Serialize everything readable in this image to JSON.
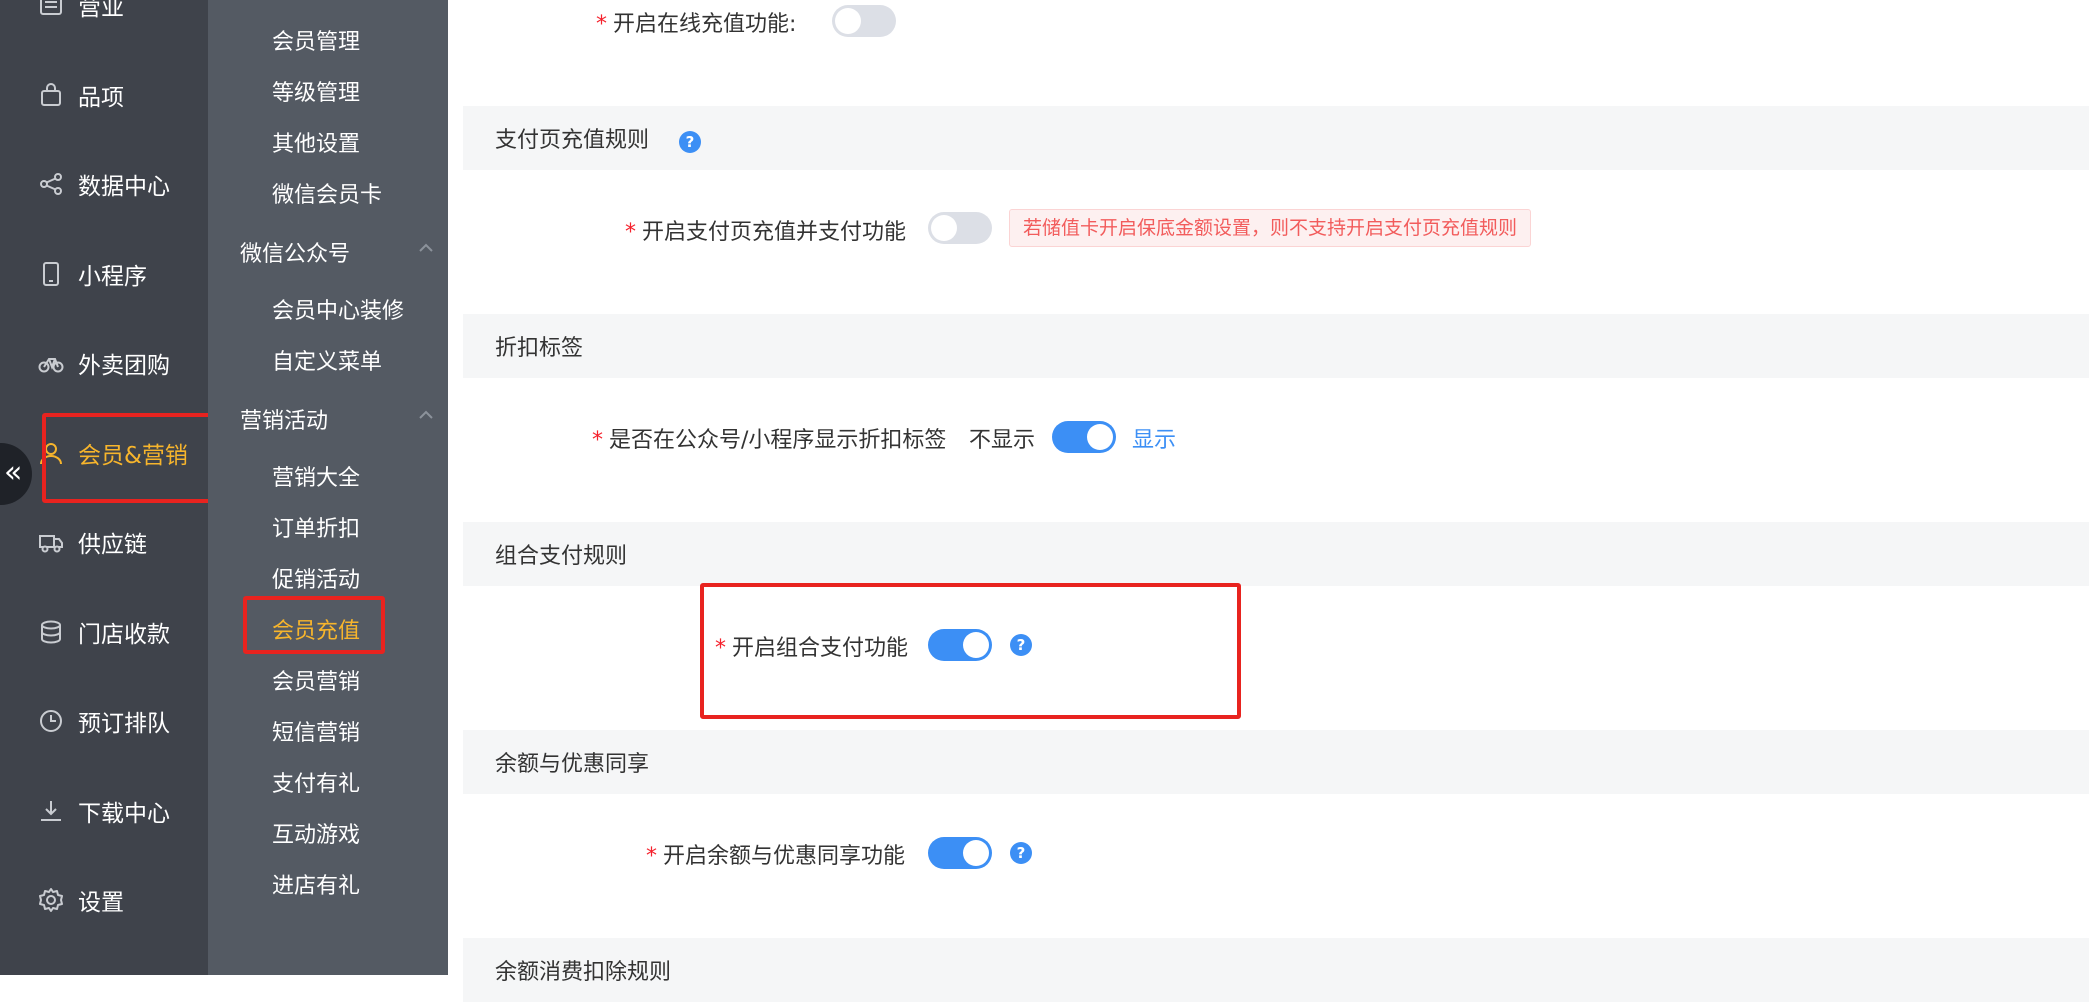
{
  "colors": {
    "nav_primary_bg": "#3f434b",
    "nav_secondary_bg": "#545a63",
    "active_text": "#f7b52c",
    "accent": "#3c8ff5",
    "highlight_border": "#e8231f",
    "warning_text": "#f25c5c"
  },
  "primary_nav": {
    "items": [
      {
        "label": "营业",
        "icon": "list-icon",
        "active": false
      },
      {
        "label": "品项",
        "icon": "bag-icon",
        "active": false
      },
      {
        "label": "数据中心",
        "icon": "share-icon",
        "active": false
      },
      {
        "label": "小程序",
        "icon": "phone-icon",
        "active": false
      },
      {
        "label": "外卖团购",
        "icon": "bicycle-icon",
        "active": false
      },
      {
        "label": "会员&营销",
        "icon": "user-icon",
        "active": true
      },
      {
        "label": "供应链",
        "icon": "truck-icon",
        "active": false
      },
      {
        "label": "门店收款",
        "icon": "coins-icon",
        "active": false
      },
      {
        "label": "预订排队",
        "icon": "clock-icon",
        "active": false
      },
      {
        "label": "下载中心",
        "icon": "download-icon",
        "active": false
      },
      {
        "label": "设置",
        "icon": "gear-icon",
        "active": false
      }
    ],
    "collapse_icon": "«"
  },
  "secondary_nav": {
    "member_items": [
      "会员管理",
      "等级管理",
      "其他设置",
      "微信会员卡"
    ],
    "wechat_group": {
      "label": "微信公众号",
      "items": [
        "会员中心装修",
        "自定义菜单"
      ]
    },
    "marketing_group": {
      "label": "营销活动",
      "items": [
        "营销大全",
        "订单折扣",
        "促销活动",
        "会员充值",
        "会员营销",
        "短信营销",
        "支付有礼",
        "互动游戏",
        "进店有礼"
      ],
      "active": "会员充值"
    }
  },
  "main": {
    "online_recharge": {
      "required_mark": "*",
      "label": "开启在线充值功能:",
      "enabled": false
    },
    "pay_page_section": {
      "title": "支付页充值规则",
      "help_icon": "?",
      "row": {
        "required_mark": "*",
        "label": "开启支付页充值并支付功能",
        "enabled": false
      },
      "warning": "若储值卡开启保底金额设置，则不支持开启支付页充值规则"
    },
    "discount_section": {
      "title": "折扣标签",
      "row": {
        "required_mark": "*",
        "label": "是否在公众号/小程序显示折扣标签",
        "off_text": "不显示",
        "on_text": "显示",
        "enabled": true
      }
    },
    "combo_pay_section": {
      "title": "组合支付规则",
      "row": {
        "required_mark": "*",
        "label": "开启组合支付功能",
        "enabled": true
      },
      "help_icon": "?"
    },
    "balance_section": {
      "title": "余额与优惠同享",
      "row": {
        "required_mark": "*",
        "label": "开启余额与优惠同享功能",
        "enabled": true
      },
      "help_icon": "?"
    },
    "deduction_section": {
      "title": "余额消费扣除规则"
    }
  }
}
